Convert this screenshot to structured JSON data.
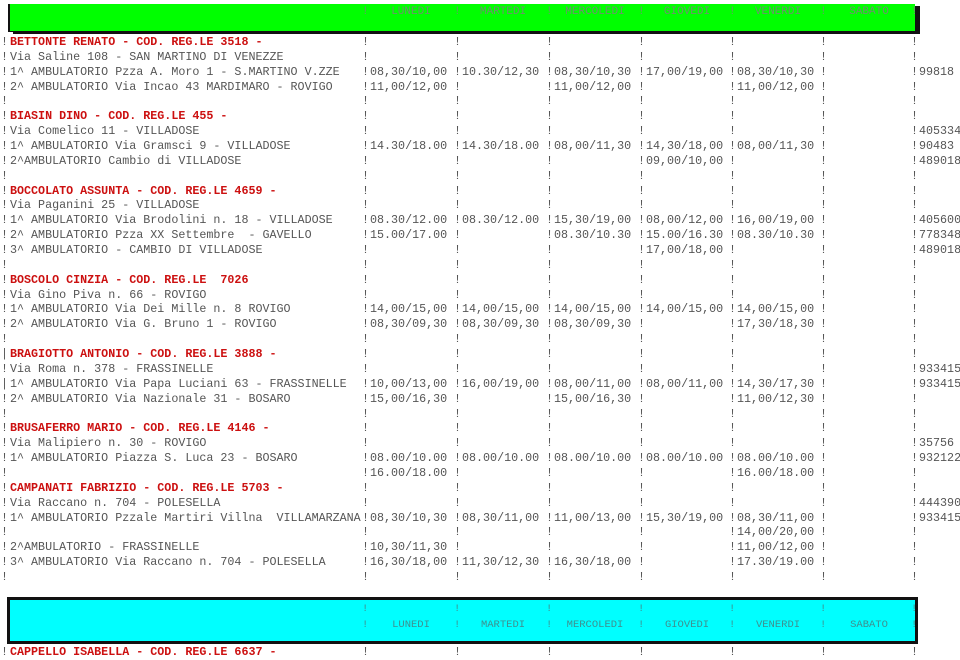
{
  "header": {
    "days": [
      "LUNEDI",
      "MARTEDI",
      "MERCOLEDI",
      "GIOVEDI",
      "VENERDI",
      "SABATO"
    ],
    "separator": "!",
    "top_color": "#00ff00",
    "bottom_color": "#00ffff"
  },
  "rows": [
    {
      "lead": "!",
      "label": "BETTONTE RENATO - COD. REG.LE 3518 -",
      "name": true,
      "days": [
        "",
        "",
        "",
        "",
        "",
        ""
      ],
      "code": ""
    },
    {
      "lead": "!",
      "label": "Via Saline 108 - SAN MARTINO DI VENEZZE",
      "days": [
        "",
        "",
        "",
        "",
        "",
        ""
      ],
      "code": ""
    },
    {
      "lead": "!",
      "label": "1^ AMBULATORIO Pzza A. Moro 1 - S.MARTINO V.ZZE",
      "days": [
        "08,30/10,00",
        "10.30/12,30",
        "08,30/10,30",
        "17,00/19,00",
        "08,30/10,30",
        ""
      ],
      "code": "99818"
    },
    {
      "lead": "!",
      "label": "2^ AMBULATORIO Via Incao 43 MARDIMARO - ROVIGO",
      "days": [
        "11,00/12,00",
        "",
        "11,00/12,00",
        "",
        "11,00/12,00",
        ""
      ],
      "code": ""
    },
    {
      "lead": "!",
      "label": "",
      "days": [
        "",
        "",
        "",
        "",
        "",
        ""
      ],
      "code": ""
    },
    {
      "lead": "!",
      "label": "BIASIN DINO - COD. REG.LE 455 -",
      "name": true,
      "days": [
        "",
        "",
        "",
        "",
        "",
        ""
      ],
      "code": ""
    },
    {
      "lead": "!",
      "label": "Via Comelico 11 - VILLADOSE",
      "days": [
        "",
        "",
        "",
        "",
        "",
        ""
      ],
      "code": "405334"
    },
    {
      "lead": "!",
      "label": "1^ AMBULATORIO Via Gramsci 9 - VILLADOSE",
      "days": [
        "14.30/18.00",
        "14.30/18.00",
        "08,00/11,30",
        "14,30/18,00",
        "08,00/11,30",
        ""
      ],
      "code": "90483"
    },
    {
      "lead": "!",
      "label": "2^AMBULATORIO Cambio di VILLADOSE",
      "days": [
        "",
        "",
        "",
        "09,00/10,00",
        "",
        ""
      ],
      "code": "489018"
    },
    {
      "lead": "!",
      "label": "",
      "days": [
        "",
        "",
        "",
        "",
        "",
        ""
      ],
      "code": ""
    },
    {
      "lead": "!",
      "label": "BOCCOLATO ASSUNTA - COD. REG.LE 4659 -",
      "name": true,
      "days": [
        "",
        "",
        "",
        "",
        "",
        ""
      ],
      "code": ""
    },
    {
      "lead": "!",
      "label": "Via Paganini 25 - VILLADOSE",
      "days": [
        "",
        "",
        "",
        "",
        "",
        ""
      ],
      "code": ""
    },
    {
      "lead": "!",
      "label": "1^ AMBULATORIO Via Brodolini n. 18 - VILLADOSE",
      "days": [
        "08.30/12.00",
        "08.30/12.00",
        "15,30/19,00",
        "08,00/12,00",
        "16,00/19,00",
        ""
      ],
      "code": "405600"
    },
    {
      "lead": "!",
      "label": "2^ AMBULATORIO Pzza XX Settembre  - GAVELLO",
      "days": [
        "15.00/17.00",
        "",
        "08.30/10.30",
        "15.00/16.30",
        "08.30/10.30",
        ""
      ],
      "code": "778348"
    },
    {
      "lead": "!",
      "label": "3^ AMBULATORIO - CAMBIO DI VILLADOSE",
      "days": [
        "",
        "",
        "",
        "17,00/18,00",
        "",
        ""
      ],
      "code": "489018"
    },
    {
      "lead": "!",
      "label": "",
      "days": [
        "",
        "",
        "",
        "",
        "",
        ""
      ],
      "code": ""
    },
    {
      "lead": "!",
      "label": "BOSCOLO CINZIA - COD. REG.LE  7026",
      "name": true,
      "days": [
        "",
        "",
        "",
        "",
        "",
        ""
      ],
      "code": ""
    },
    {
      "lead": "!",
      "label": "Via Gino Piva n. 66 - ROVIGO",
      "days": [
        "",
        "",
        "",
        "",
        "",
        ""
      ],
      "code": ""
    },
    {
      "lead": "!",
      "label": "1^ AMBULATORIO Via Dei Mille n. 8 ROVIGO",
      "days": [
        "14,00/15,00",
        "14,00/15,00",
        "14,00/15,00",
        "14,00/15,00",
        "14,00/15,00",
        ""
      ],
      "code": ""
    },
    {
      "lead": "!",
      "label": "2^ AMBULATORIO Via G. Bruno 1 - ROVIGO",
      "days": [
        "08,30/09,30",
        "08,30/09,30",
        "08,30/09,30",
        "",
        "17,30/18,30",
        ""
      ],
      "code": ""
    },
    {
      "lead": "!",
      "label": "",
      "days": [
        "",
        "",
        "",
        "",
        "",
        ""
      ],
      "code": ""
    },
    {
      "lead": "|",
      "label": "BRAGIOTTO ANTONIO - COD. REG.LE 3888 -",
      "name": true,
      "days": [
        "",
        "",
        "",
        "",
        "",
        ""
      ],
      "code": ""
    },
    {
      "lead": "!",
      "label": "Via Roma n. 378 - FRASSINELLE",
      "days": [
        "",
        "",
        "",
        "",
        "",
        ""
      ],
      "code": "933415"
    },
    {
      "lead": "|",
      "label": "1^ AMBULATORIO Via Papa Luciani 63 - FRASSINELLE",
      "days": [
        "10,00/13,00",
        "16,00/19,00",
        "08,00/11,00",
        "08,00/11,00",
        "14,30/17,30",
        ""
      ],
      "code": "933415"
    },
    {
      "lead": "!",
      "label": "2^ AMBULATORIO Via Nazionale 31 - BOSARO",
      "days": [
        "15,00/16,30",
        "",
        "15,00/16,30",
        "",
        "11,00/12,30",
        ""
      ],
      "code": ""
    },
    {
      "lead": "!",
      "label": "",
      "days": [
        "",
        "",
        "",
        "",
        "",
        ""
      ],
      "code": ""
    },
    {
      "lead": "!",
      "label": "BRUSAFERRO MARIO - COD. REG.LE 4146 -",
      "name": true,
      "days": [
        "",
        "",
        "",
        "",
        "",
        ""
      ],
      "code": ""
    },
    {
      "lead": "!",
      "label": "Via Malipiero n. 30 - ROVIGO",
      "days": [
        "",
        "",
        "",
        "",
        "",
        ""
      ],
      "code": "35756"
    },
    {
      "lead": "!",
      "label": "1^ AMBULATORIO Piazza S. Luca 23 - BOSARO",
      "days": [
        "08.00/10.00",
        "08.00/10.00",
        "08.00/10.00",
        "08.00/10.00",
        "08.00/10.00",
        ""
      ],
      "code": "932122"
    },
    {
      "lead": "!",
      "label": "",
      "days": [
        "16.00/18.00",
        "",
        "",
        "",
        "16.00/18.00",
        ""
      ],
      "code": ""
    },
    {
      "lead": "!",
      "label": "CAMPANATI FABRIZIO - COD. REG.LE 5703 -",
      "name": true,
      "days": [
        "",
        "",
        "",
        "",
        "",
        ""
      ],
      "code": ""
    },
    {
      "lead": "!",
      "label": "Via Raccano n. 704 - POLESELLA",
      "days": [
        "",
        "",
        "",
        "",
        "",
        ""
      ],
      "code": "444390"
    },
    {
      "lead": "!",
      "label": "1^ AMBULATORIO Pzzale Martiri Villna  VILLAMARZANA",
      "days": [
        "08,30/10,30",
        "08,30/11,00",
        "11,00/13,00",
        "15,30/19,00",
        "08,30/11,00",
        ""
      ],
      "code": "933415"
    },
    {
      "lead": "!",
      "label": "",
      "days": [
        "",
        "",
        "",
        "",
        "14,00/20,00",
        ""
      ],
      "code": ""
    },
    {
      "lead": "!",
      "label": "2^AMBULATORIO - FRASSINELLE",
      "days": [
        "10,30/11,30",
        "",
        "",
        "",
        "11,00/12,00",
        ""
      ],
      "code": ""
    },
    {
      "lead": "!",
      "label": "3^ AMBULATORIO Via Raccano n. 704 - POLESELLA",
      "days": [
        "16,30/18,00",
        "11,30/12,30",
        "16,30/18,00",
        "",
        "17.30/19.00",
        ""
      ],
      "code": ""
    },
    {
      "lead": "!",
      "label": "",
      "days": [
        "",
        "",
        "",
        "",
        "",
        ""
      ],
      "code": ""
    }
  ],
  "after_rows": [
    {
      "lead": "!",
      "label": "CAPPELLO ISABELLA - COD. REG.LE 6637 -",
      "name": true,
      "days": [
        "",
        "",
        "",
        "",
        "",
        ""
      ],
      "code": ""
    }
  ]
}
